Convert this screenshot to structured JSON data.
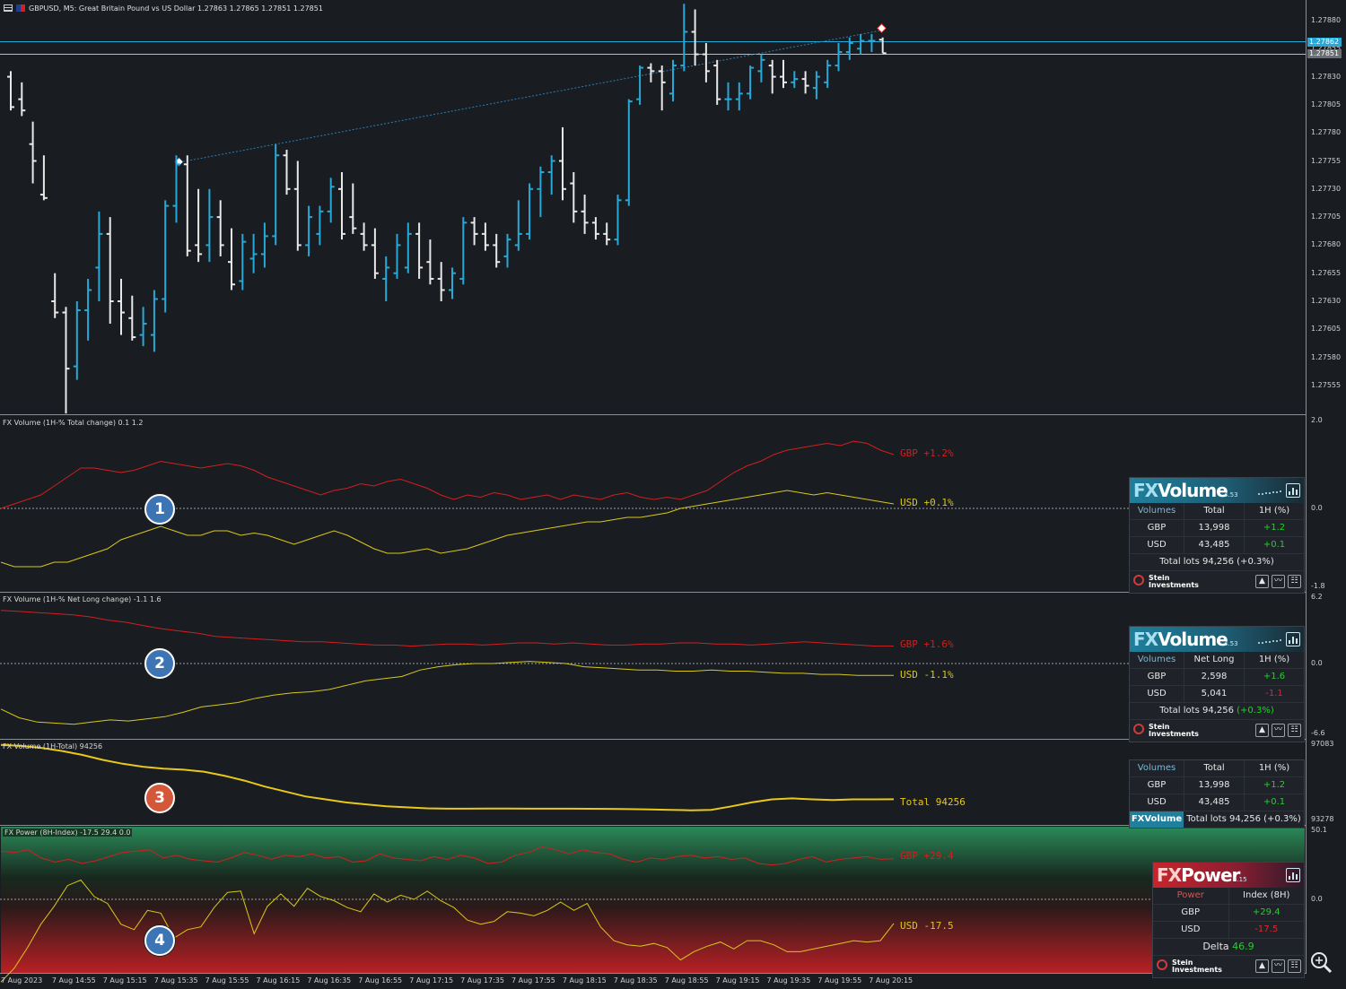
{
  "symbol_header": {
    "title": "GBPUSD, M5:  Great Britain Pound vs US Dollar  1.27863 1.27865 1.27851 1.27851"
  },
  "price_axis": [
    "1.27880",
    "1.27855",
    "1.27830",
    "1.27805",
    "1.27780",
    "1.27755",
    "1.27730",
    "1.27705",
    "1.27680",
    "1.27655",
    "1.27630",
    "1.27605",
    "1.27580",
    "1.27555"
  ],
  "price_tags": {
    "ask": "1.27862",
    "bid": "1.27851",
    "hidden": "1.27855"
  },
  "time_axis": [
    "7 Aug 2023",
    "7 Aug 14:55",
    "7 Aug 15:15",
    "7 Aug 15:35",
    "7 Aug 15:55",
    "7 Aug 16:15",
    "7 Aug 16:35",
    "7 Aug 16:55",
    "7 Aug 17:15",
    "7 Aug 17:35",
    "7 Aug 17:55",
    "7 Aug 18:15",
    "7 Aug 18:35",
    "7 Aug 18:55",
    "7 Aug 19:15",
    "7 Aug 19:35",
    "7 Aug 19:55",
    "7 Aug 20:15"
  ],
  "panels": {
    "p1": {
      "title": "FX Volume (1H-% Total change)  0.1 1.2",
      "axis_top": "2.0",
      "axis_mid": "0.0",
      "axis_bottom": "-1.8",
      "gbp_label": "GBP +1.2%",
      "usd_label": "USD +0.1%",
      "badge": "1"
    },
    "p2": {
      "title": "FX Volume (1H-% Net Long change)  -1.1 1.6",
      "axis_top": "6.2",
      "axis_mid": "0.0",
      "axis_bottom": "-6.6",
      "gbp_label": "GBP +1.6%",
      "usd_label": "USD -1.1%",
      "badge": "2"
    },
    "p3": {
      "title": "FX Volume (1H-Total)  94256",
      "axis_top": "97083",
      "axis_bottom": "93278",
      "total_label": "Total 94256",
      "badge": "3"
    },
    "p4": {
      "title": "FX Power (8H-Index) -17.5 29.4 0.0",
      "axis_top": "50.1",
      "axis_mid": "0.0",
      "gbp_label": "GBP +29.4",
      "usd_label": "USD -17.5",
      "badge": "4"
    }
  },
  "widget1": {
    "logo_fx": "FX",
    "logo_rest": "Volume",
    "version": "4.53",
    "headers": [
      "Volumes",
      "Total",
      "1H (%)"
    ],
    "rows": [
      [
        "GBP",
        "13,998",
        "+1.2"
      ],
      [
        "USD",
        "43,485",
        "+0.1"
      ]
    ],
    "total": "Total lots 94,256 (+0.3%)",
    "brand_line1": "Stein",
    "brand_line2": "Investments"
  },
  "widget2": {
    "logo_fx": "FX",
    "logo_rest": "Volume",
    "version": "4.53",
    "headers": [
      "Volumes",
      "Net Long",
      "1H (%)"
    ],
    "rows": [
      [
        "GBP",
        "2,598",
        "+1.6"
      ],
      [
        "USD",
        "5,041",
        "-1.1"
      ]
    ],
    "total_prefix": "Total lots 94,256",
    "total_change": "(+0.3%)",
    "brand_line1": "Stein",
    "brand_line2": "Investments"
  },
  "widget3": {
    "headers": [
      "Volumes",
      "Total",
      "1H (%)"
    ],
    "rows": [
      [
        "GBP",
        "13,998",
        "+1.2"
      ],
      [
        "USD",
        "43,485",
        "+0.1"
      ]
    ],
    "tag": "FXVolume",
    "total": "Total lots 94,256 (+0.3%)"
  },
  "widget4": {
    "logo_fx": "FX",
    "logo_rest": "Power",
    "version": "4.15",
    "headers": [
      "Power",
      "Index (8H)"
    ],
    "rows": [
      [
        "GBP",
        "+29.4"
      ],
      [
        "USD",
        "-17.5"
      ]
    ],
    "delta_label": "Delta",
    "delta_value": "46.9",
    "brand_line1": "Stein",
    "brand_line2": "Investments"
  },
  "colors": {
    "bull": "#26a9d8",
    "bear": "#e8e8e8",
    "gbp": "#d0201f",
    "usd": "#d8c81c",
    "total": "#e8c81a"
  },
  "chart_data": {
    "type": "ohlc",
    "bars": [
      [
        1.2783,
        1.27835,
        1.278,
        1.27803
      ],
      [
        1.2781,
        1.27825,
        1.27795,
        1.278
      ],
      [
        1.2777,
        1.2779,
        1.27735,
        1.27755
      ],
      [
        1.27725,
        1.2776,
        1.2772,
        1.27722
      ],
      [
        1.2763,
        1.27655,
        1.27615,
        1.2762
      ],
      [
        1.2762,
        1.27625,
        1.2753,
        1.2757
      ],
      [
        1.27572,
        1.2763,
        1.2756,
        1.27622
      ],
      [
        1.27622,
        1.2765,
        1.27595,
        1.2764
      ],
      [
        1.2766,
        1.2771,
        1.2763,
        1.2769
      ],
      [
        1.2769,
        1.27705,
        1.2761,
        1.2763
      ],
      [
        1.2763,
        1.2765,
        1.276,
        1.2762
      ],
      [
        1.27615,
        1.27635,
        1.27595,
        1.27598
      ],
      [
        1.276,
        1.27625,
        1.2759,
        1.2761
      ],
      [
        1.276,
        1.2764,
        1.27585,
        1.27632
      ],
      [
        1.27632,
        1.2772,
        1.2762,
        1.27715
      ],
      [
        1.27715,
        1.2776,
        1.277,
        1.27752
      ],
      [
        1.27752,
        1.2776,
        1.2767,
        1.27675
      ],
      [
        1.2768,
        1.2773,
        1.27665,
        1.27672
      ],
      [
        1.2768,
        1.2773,
        1.27665,
        1.27705
      ],
      [
        1.27705,
        1.2772,
        1.2767,
        1.2768
      ],
      [
        1.27665,
        1.27695,
        1.2764,
        1.27645
      ],
      [
        1.27648,
        1.2769,
        1.2764,
        1.27683
      ],
      [
        1.27668,
        1.2769,
        1.27655,
        1.27672
      ],
      [
        1.27672,
        1.277,
        1.2766,
        1.27688
      ],
      [
        1.27688,
        1.2777,
        1.2768,
        1.2776
      ],
      [
        1.2776,
        1.27765,
        1.27725,
        1.2773
      ],
      [
        1.2773,
        1.27755,
        1.27675,
        1.2768
      ],
      [
        1.2768,
        1.27715,
        1.2767,
        1.27705
      ],
      [
        1.2769,
        1.27715,
        1.2768,
        1.2771
      ],
      [
        1.2771,
        1.2774,
        1.277,
        1.27732
      ],
      [
        1.2773,
        1.27745,
        1.27685,
        1.2769
      ],
      [
        1.27705,
        1.27735,
        1.2769,
        1.27695
      ],
      [
        1.2769,
        1.277,
        1.27675,
        1.2768
      ],
      [
        1.2768,
        1.27695,
        1.2765,
        1.27655
      ],
      [
        1.2765,
        1.2767,
        1.2763,
        1.2766
      ],
      [
        1.27655,
        1.2769,
        1.2765,
        1.2768
      ],
      [
        1.2766,
        1.277,
        1.27655,
        1.2769
      ],
      [
        1.2769,
        1.277,
        1.2765,
        1.2766
      ],
      [
        1.27665,
        1.27685,
        1.27645,
        1.2765
      ],
      [
        1.2765,
        1.27665,
        1.2763,
        1.2764
      ],
      [
        1.2764,
        1.2766,
        1.27632,
        1.27655
      ],
      [
        1.2765,
        1.27705,
        1.27645,
        1.277
      ],
      [
        1.277,
        1.27705,
        1.2768,
        1.2769
      ],
      [
        1.2769,
        1.277,
        1.27675,
        1.2768
      ],
      [
        1.2768,
        1.2769,
        1.2766,
        1.27665
      ],
      [
        1.2767,
        1.2769,
        1.2766,
        1.27685
      ],
      [
        1.2768,
        1.2772,
        1.27675,
        1.2769
      ],
      [
        1.2769,
        1.27735,
        1.27685,
        1.2773
      ],
      [
        1.2773,
        1.2775,
        1.27705,
        1.27745
      ],
      [
        1.27745,
        1.2776,
        1.27725,
        1.27755
      ],
      [
        1.27755,
        1.27785,
        1.2772,
        1.2773
      ],
      [
        1.27735,
        1.27745,
        1.277,
        1.2771
      ],
      [
        1.2771,
        1.27725,
        1.2769,
        1.277
      ],
      [
        1.277,
        1.27705,
        1.27685,
        1.2769
      ],
      [
        1.2769,
        1.277,
        1.2768,
        1.27685
      ],
      [
        1.27685,
        1.27725,
        1.2768,
        1.2772
      ],
      [
        1.2772,
        1.2781,
        1.27715,
        1.27808
      ],
      [
        1.2781,
        1.2784,
        1.27805,
        1.27838
      ],
      [
        1.27838,
        1.27842,
        1.27825,
        1.27835
      ],
      [
        1.27835,
        1.2784,
        1.278,
        1.27825
      ],
      [
        1.27815,
        1.27845,
        1.27808,
        1.2784
      ],
      [
        1.2784,
        1.27895,
        1.27835,
        1.2787
      ],
      [
        1.2787,
        1.2789,
        1.2784,
        1.2785
      ],
      [
        1.2785,
        1.2786,
        1.27825,
        1.27835
      ],
      [
        1.2784,
        1.27845,
        1.27805,
        1.2781
      ],
      [
        1.2781,
        1.27825,
        1.278,
        1.2781
      ],
      [
        1.2781,
        1.27825,
        1.278,
        1.27815
      ],
      [
        1.27815,
        1.2784,
        1.2781,
        1.27838
      ],
      [
        1.27835,
        1.2785,
        1.27825,
        1.27845
      ],
      [
        1.2784,
        1.27845,
        1.27815,
        1.2783
      ],
      [
        1.2783,
        1.27845,
        1.2782,
        1.27825
      ],
      [
        1.27825,
        1.27835,
        1.2782,
        1.27828
      ],
      [
        1.27828,
        1.27835,
        1.27815,
        1.27822
      ],
      [
        1.2782,
        1.27835,
        1.2781,
        1.2783
      ],
      [
        1.27825,
        1.27845,
        1.2782,
        1.2784
      ],
      [
        1.2784,
        1.2786,
        1.27835,
        1.27852
      ],
      [
        1.27852,
        1.27865,
        1.27845,
        1.2786
      ],
      [
        1.27855,
        1.27868,
        1.2785,
        1.27862
      ],
      [
        1.27862,
        1.27868,
        1.27852,
        1.27862
      ],
      [
        1.27863,
        1.27865,
        1.27851,
        1.27851
      ]
    ],
    "lines": {
      "p1_gbp": [
        0.0,
        0.1,
        0.2,
        0.3,
        0.5,
        0.7,
        0.9,
        0.9,
        0.85,
        0.8,
        0.85,
        0.95,
        1.05,
        1.0,
        0.95,
        0.9,
        0.95,
        1.0,
        0.95,
        0.85,
        0.7,
        0.6,
        0.5,
        0.4,
        0.3,
        0.4,
        0.45,
        0.55,
        0.5,
        0.6,
        0.65,
        0.55,
        0.45,
        0.3,
        0.2,
        0.3,
        0.25,
        0.35,
        0.3,
        0.2,
        0.25,
        0.3,
        0.2,
        0.3,
        0.25,
        0.2,
        0.3,
        0.35,
        0.25,
        0.2,
        0.25,
        0.2,
        0.3,
        0.4,
        0.6,
        0.8,
        0.95,
        1.05,
        1.2,
        1.3,
        1.35,
        1.4,
        1.45,
        1.4,
        1.5,
        1.45,
        1.3,
        1.2
      ],
      "p1_usd": [
        -1.2,
        -1.3,
        -1.3,
        -1.3,
        -1.2,
        -1.2,
        -1.1,
        -1.0,
        -0.9,
        -0.7,
        -0.6,
        -0.5,
        -0.4,
        -0.5,
        -0.6,
        -0.6,
        -0.5,
        -0.5,
        -0.6,
        -0.55,
        -0.6,
        -0.7,
        -0.8,
        -0.7,
        -0.6,
        -0.5,
        -0.6,
        -0.75,
        -0.9,
        -1.0,
        -1.0,
        -0.95,
        -0.9,
        -1.0,
        -0.95,
        -0.9,
        -0.8,
        -0.7,
        -0.6,
        -0.55,
        -0.5,
        -0.45,
        -0.4,
        -0.35,
        -0.3,
        -0.3,
        -0.25,
        -0.2,
        -0.2,
        -0.15,
        -0.1,
        0.0,
        0.05,
        0.1,
        0.15,
        0.2,
        0.25,
        0.3,
        0.35,
        0.4,
        0.35,
        0.3,
        0.35,
        0.3,
        0.25,
        0.2,
        0.15,
        0.1
      ],
      "p2_gbp": [
        4.9,
        4.8,
        4.7,
        4.6,
        4.5,
        4.3,
        4.0,
        3.8,
        3.5,
        3.2,
        3.0,
        2.8,
        2.5,
        2.4,
        2.3,
        2.2,
        2.1,
        2.0,
        2.0,
        1.9,
        1.8,
        1.7,
        1.7,
        1.6,
        1.7,
        1.8,
        1.8,
        1.7,
        1.8,
        1.9,
        1.9,
        1.8,
        1.9,
        1.8,
        1.7,
        1.7,
        1.8,
        1.8,
        1.9,
        1.9,
        1.8,
        1.8,
        1.7,
        1.8,
        1.9,
        2.0,
        1.9,
        1.8,
        1.7,
        1.6,
        1.6
      ],
      "p2_usd": [
        -4.2,
        -5.0,
        -5.4,
        -5.5,
        -5.6,
        -5.4,
        -5.2,
        -5.3,
        -5.1,
        -4.9,
        -4.5,
        -4.0,
        -3.8,
        -3.6,
        -3.2,
        -2.9,
        -2.7,
        -2.6,
        -2.4,
        -2.0,
        -1.6,
        -1.4,
        -1.2,
        -0.6,
        -0.3,
        -0.1,
        0.0,
        0.0,
        0.1,
        0.2,
        0.1,
        0.0,
        -0.3,
        -0.4,
        -0.5,
        -0.6,
        -0.6,
        -0.7,
        -0.7,
        -0.6,
        -0.7,
        -0.7,
        -0.8,
        -0.9,
        -0.9,
        -1.0,
        -1.0,
        -1.1,
        -1.1,
        -1.1
      ],
      "p3_total": [
        97000,
        96950,
        96850,
        96700,
        96500,
        96250,
        96050,
        95900,
        95800,
        95750,
        95650,
        95450,
        95200,
        94900,
        94650,
        94400,
        94250,
        94100,
        94000,
        93900,
        93850,
        93800,
        93780,
        93780,
        93790,
        93790,
        93780,
        93780,
        93780,
        93775,
        93770,
        93760,
        93740,
        93720,
        93700,
        93720,
        93900,
        94100,
        94250,
        94300,
        94250,
        94220,
        94250,
        94250,
        94256
      ],
      "p4_gbp": [
        35,
        34,
        36,
        30,
        27,
        29,
        26,
        28,
        31,
        34,
        35,
        36,
        30,
        32,
        29,
        28,
        27,
        30,
        34,
        32,
        29,
        32,
        31,
        33,
        30,
        31,
        27,
        28,
        33,
        30,
        29,
        28,
        31,
        29,
        32,
        30,
        26,
        27,
        32,
        34,
        38,
        36,
        33,
        36,
        34,
        33,
        29,
        27,
        30,
        29,
        31,
        32,
        30,
        31,
        29,
        30,
        26,
        25,
        26,
        29,
        31,
        27,
        29,
        30,
        31,
        29,
        29.4
      ],
      "p4_usd": [
        -60,
        -50,
        -35,
        -18,
        -5,
        10,
        14,
        2,
        -3,
        -18,
        -22,
        -8,
        -10,
        -28,
        -22,
        -20,
        -6,
        5,
        6,
        -25,
        -5,
        4,
        -5,
        8,
        2,
        -1,
        -6,
        -9,
        4,
        -2,
        3,
        0,
        6,
        -1,
        -6,
        -15,
        -18,
        -16,
        -9,
        -10,
        -12,
        -8,
        -2,
        -8,
        -3,
        -20,
        -30,
        -33,
        -34,
        -32,
        -35,
        -44,
        -38,
        -34,
        -31,
        -36,
        -30,
        -30,
        -33,
        -38,
        -38,
        -36,
        -34,
        -32,
        -30,
        -31,
        -30,
        -17.5
      ]
    }
  }
}
